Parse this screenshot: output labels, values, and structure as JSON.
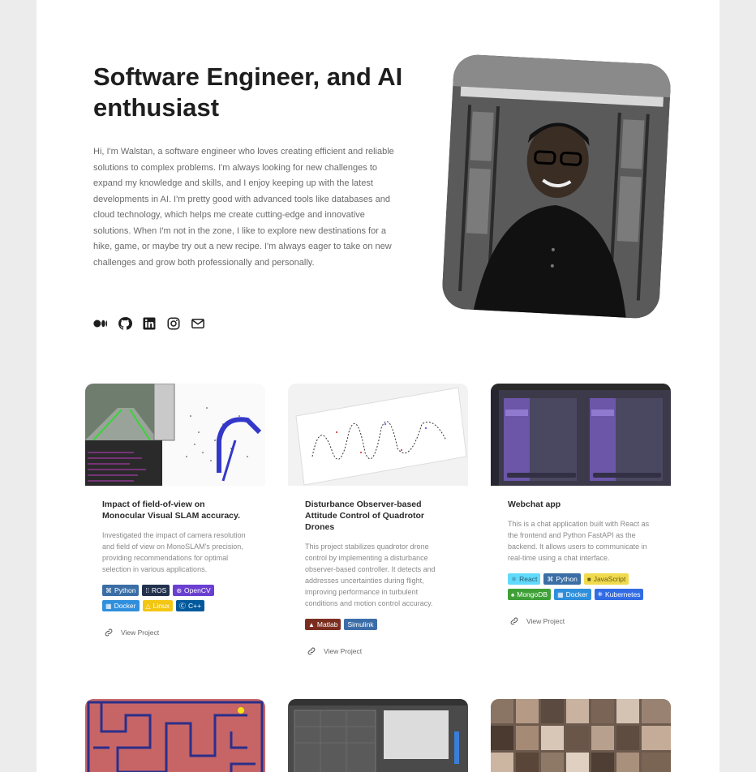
{
  "hero": {
    "title": "Software Engineer, and AI enthusiast",
    "bio": "Hi, I'm Walstan, a software engineer who loves creating efficient and reliable solutions to complex problems. I'm always looking for new challenges to expand my knowledge and skills, and I enjoy keeping up with the latest developments in AI. I'm pretty good with advanced tools like databases and cloud technology, which helps me create cutting-edge and innovative solutions. When I'm not in the zone, I like to explore new destinations for a hike, game, or maybe try out a new recipe. I'm always eager to take on new challenges and grow both professionally and personally.",
    "portrait_icon": "person-photo"
  },
  "socials": [
    {
      "name": "medium",
      "icon": "medium-icon"
    },
    {
      "name": "github",
      "icon": "github-icon"
    },
    {
      "name": "linkedin",
      "icon": "linkedin-icon"
    },
    {
      "name": "instagram",
      "icon": "instagram-icon"
    },
    {
      "name": "email",
      "icon": "mail-icon"
    }
  ],
  "projects": [
    {
      "title": "Impact of field-of-view on Monocular Visual SLAM accuracy.",
      "description": "Investigated the impact of camera resolution and field of view on MonoSLAM's precision, providing recommendations for optimal selection in various applications.",
      "tags": [
        {
          "label": "Python",
          "color": "#3a6ea5",
          "icon": "python-icon"
        },
        {
          "label": "ROS",
          "color": "#22314e",
          "icon": "ros-icon"
        },
        {
          "label": "OpenCV",
          "color": "#6a3fd1",
          "icon": "opencv-icon"
        },
        {
          "label": "Docker",
          "color": "#2f8fdc",
          "icon": "docker-icon"
        },
        {
          "label": "Linux",
          "color": "#f3c613",
          "icon": "linux-icon"
        },
        {
          "label": "C++",
          "color": "#00599c",
          "icon": "cpp-icon"
        }
      ],
      "link_label": "View Project"
    },
    {
      "title": "Disturbance Observer-based Attitude Control of Quadrotor Drones",
      "description": "This project stabilizes quadrotor drone control by implementing a disturbance observer-based controller. It detects and addresses uncertainties during flight, improving performance in turbulent conditions and motion control accuracy.",
      "tags": [
        {
          "label": "Matlab",
          "color": "#7b2e20",
          "icon": "matlab-icon"
        },
        {
          "label": "Simulink",
          "color": "#3b6ea8",
          "icon": ""
        }
      ],
      "link_label": "View Project"
    },
    {
      "title": "Webchat app",
      "description": "This is a chat application built with React as the frontend and Python FastAPI as the backend. It allows users to communicate in real-time using a chat interface.",
      "tags": [
        {
          "label": "React",
          "color": "#61dafb",
          "icon": "react-icon"
        },
        {
          "label": "Python",
          "color": "#3a6ea5",
          "icon": "python-icon"
        },
        {
          "label": "JavaScript",
          "color": "#f0db4f",
          "icon": "js-icon"
        },
        {
          "label": "MongoDB",
          "color": "#3fa037",
          "icon": "mongodb-icon"
        },
        {
          "label": "Docker",
          "color": "#2f8fdc",
          "icon": "docker-icon"
        },
        {
          "label": "Kubernetes",
          "color": "#326ce5",
          "icon": "kubernetes-icon"
        }
      ],
      "link_label": "View Project"
    }
  ],
  "colors": {
    "page_bg": "#ececec",
    "card_bg": "#ffffff",
    "title": "#1e1e1e",
    "body_text": "#6a6a6a"
  }
}
